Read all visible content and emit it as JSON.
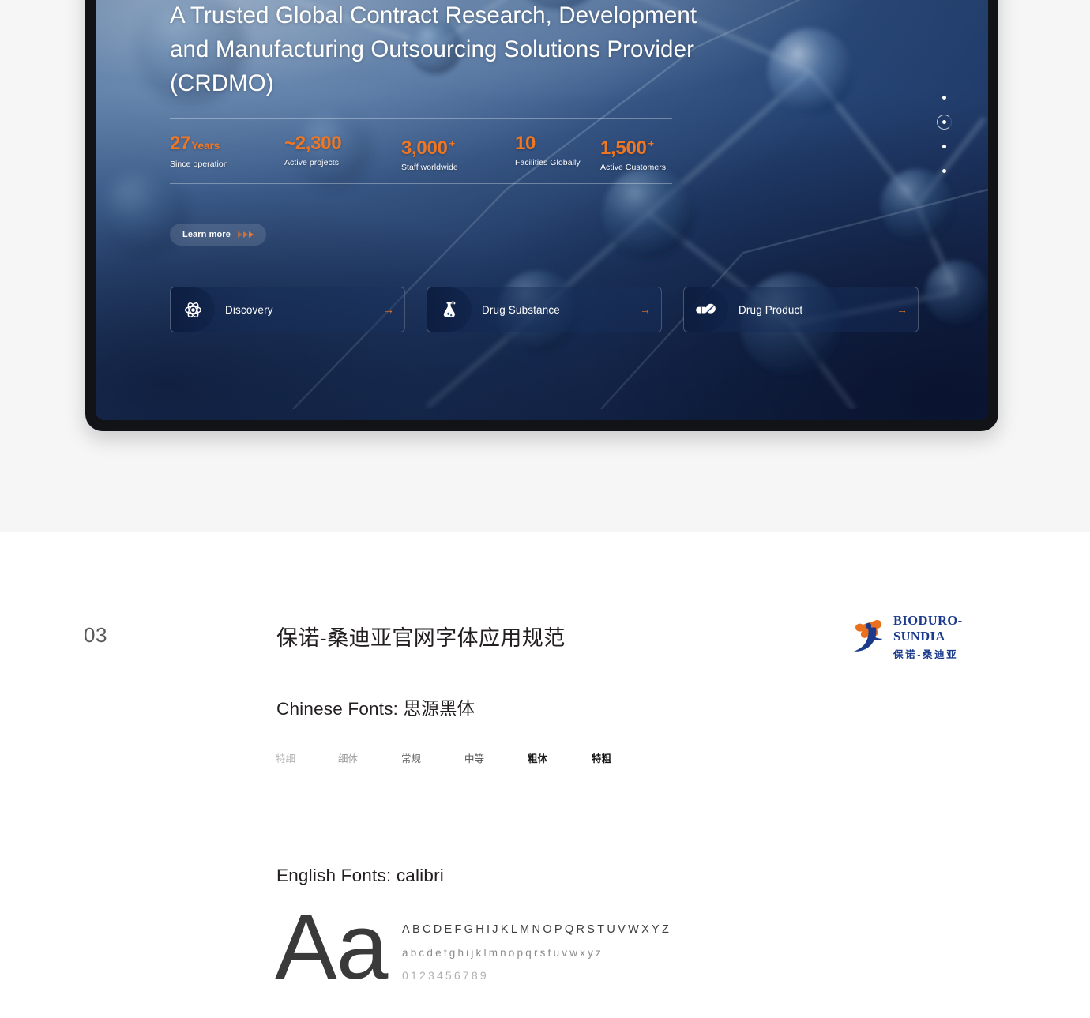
{
  "hero": {
    "title": "A Trusted Global Contract Research, Development and Manufacturing Outsourcing Solutions Provider (CRDMO)",
    "stats": [
      {
        "value": "27",
        "unit": "Years",
        "plus": "",
        "label": "Since operation"
      },
      {
        "value": "~2,300",
        "unit": "",
        "plus": "",
        "label": "Active projects"
      },
      {
        "value": "3,000",
        "unit": "",
        "plus": "+",
        "label": "Staff worldwide"
      },
      {
        "value": "10",
        "unit": "",
        "plus": "",
        "label": "Facilities Globally"
      },
      {
        "value": "1,500",
        "unit": "",
        "plus": "+",
        "label": "Active Customers"
      }
    ],
    "learn_more_label": "Learn more",
    "cards": [
      {
        "label": "Discovery",
        "icon": "atom-icon",
        "arrow": "→"
      },
      {
        "label": "Drug Substance",
        "icon": "flask-icon",
        "arrow": "→"
      },
      {
        "label": "Drug Product",
        "icon": "capsule-icon",
        "arrow": "→"
      }
    ],
    "carousel": {
      "count": 4,
      "active_index": 1
    },
    "accent_color": "#ef7622",
    "background_color": "#1d3563"
  },
  "spec": {
    "section_number": "03",
    "section_title": "保诺-桑迪亚官网字体应用规范",
    "chinese_heading": "Chinese Fonts: 思源黑体",
    "weight_labels": [
      "特细",
      "细体",
      "常规",
      "中等",
      "粗体",
      "特粗"
    ],
    "english_heading": "English Fonts: calibri",
    "specimen_aa": "Aa",
    "specimen_uppercase": "ABCDEFGHIJKLMNOPQRSTUVWXYZ",
    "specimen_lowercase": "abcdefghijklmnopqrstuvwxyz",
    "specimen_numbers": "0123456789"
  },
  "logo": {
    "english": "BIODURO-SUNDIA",
    "chinese": "保诺-桑迪亚",
    "color": "#1b3a8c"
  }
}
